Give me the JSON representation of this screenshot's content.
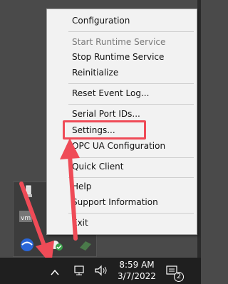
{
  "context_menu": {
    "items": [
      {
        "label": "Configuration",
        "enabled": true
      },
      {
        "label": "Start Runtime Service",
        "enabled": false
      },
      {
        "label": "Stop Runtime Service",
        "enabled": true
      },
      {
        "label": "Reinitialize",
        "enabled": true
      },
      {
        "label": "Reset Event Log...",
        "enabled": true
      },
      {
        "label": "Serial Port IDs...",
        "enabled": true
      },
      {
        "label": "Settings...",
        "enabled": true,
        "highlighted": true
      },
      {
        "label": "OPC UA Configuration",
        "enabled": true
      },
      {
        "label": "Quick Client",
        "enabled": true
      },
      {
        "label": "Help",
        "enabled": true
      },
      {
        "label": "Support Information",
        "enabled": true
      },
      {
        "label": "Exit",
        "enabled": true
      }
    ]
  },
  "taskbar": {
    "time": "8:59 AM",
    "date": "3/7/2022",
    "notification_count": "2"
  },
  "colors": {
    "annotation_red": "#ef4b57",
    "menu_bg": "#f2f2f2",
    "taskbar_bg": "#1f1f1f"
  }
}
